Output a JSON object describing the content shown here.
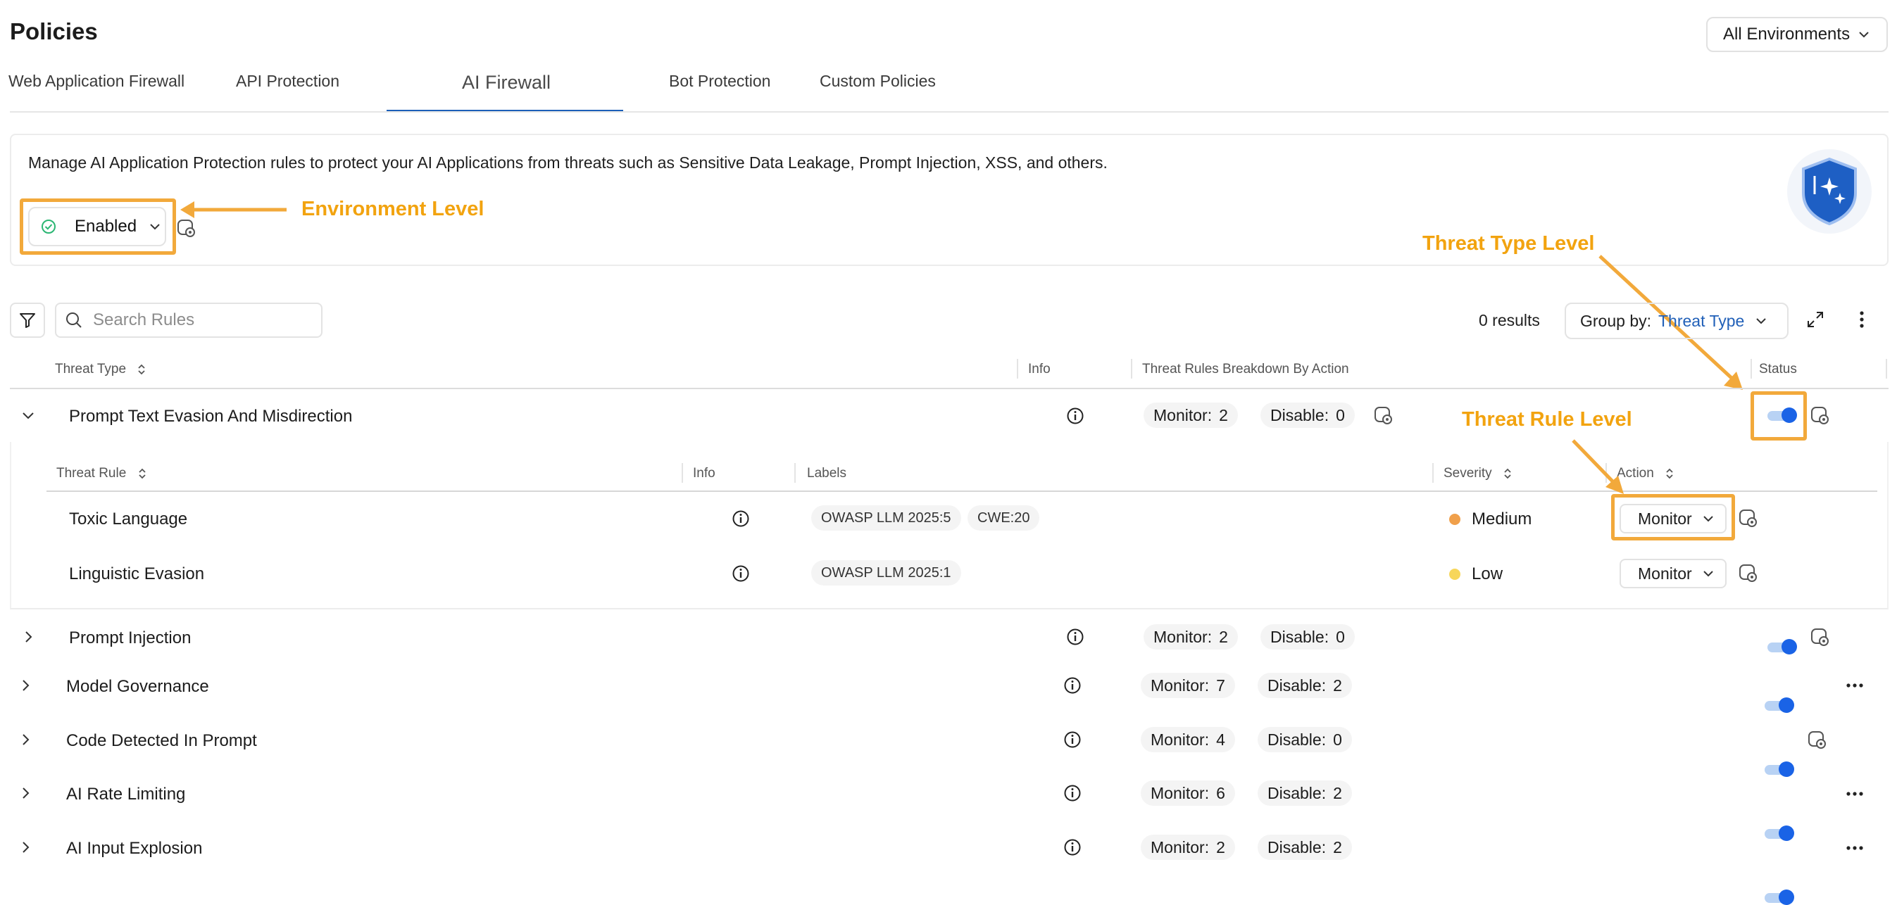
{
  "header": {
    "title": "Policies",
    "environment_select": "All Environments"
  },
  "tabs": [
    {
      "label": "Web Application Firewall",
      "active": false
    },
    {
      "label": "API Protection",
      "active": false
    },
    {
      "label": "AI Firewall",
      "active": true
    },
    {
      "label": "Bot Protection",
      "active": false
    },
    {
      "label": "Custom Policies",
      "active": false
    }
  ],
  "intro": {
    "description": "Manage AI Application Protection rules to protect your AI Applications from threats such as Sensitive Data Leakage, Prompt Injection, XSS, and others.",
    "status_label": "Enabled"
  },
  "annotations": {
    "environment_level": "Environment Level",
    "threat_type_level": "Threat Type Level",
    "threat_rule_level": "Threat Rule Level",
    "accent_color": "#f2a93b"
  },
  "toolbar": {
    "search_placeholder": "Search Rules",
    "results": "0 results",
    "group_by_label": "Group by:",
    "group_by_value": "Threat Type"
  },
  "table": {
    "columns": {
      "threat_type": "Threat Type",
      "info": "Info",
      "breakdown": "Threat Rules Breakdown By Action",
      "status": "Status"
    },
    "monitor_label": "Monitor:",
    "disable_label": "Disable:",
    "rows": [
      {
        "name": "Prompt Text Evasion And Misdirection",
        "monitor": "2",
        "disable": "0",
        "expanded": true,
        "enabled": true,
        "trailing": "policy-icon"
      },
      {
        "name": "Prompt Injection",
        "monitor": "2",
        "disable": "0",
        "expanded": false,
        "enabled": true,
        "trailing": "policy-icon"
      },
      {
        "name": "Model Governance",
        "monitor": "7",
        "disable": "2",
        "expanded": false,
        "enabled": true,
        "trailing": "more-icon"
      },
      {
        "name": "Code Detected In Prompt",
        "monitor": "4",
        "disable": "0",
        "expanded": false,
        "enabled": true,
        "trailing": "policy-icon"
      },
      {
        "name": "AI Rate Limiting",
        "monitor": "6",
        "disable": "2",
        "expanded": false,
        "enabled": true,
        "trailing": "more-icon"
      },
      {
        "name": "AI Input Explosion",
        "monitor": "2",
        "disable": "2",
        "expanded": false,
        "enabled": true,
        "trailing": "more-icon"
      }
    ]
  },
  "subtable": {
    "columns": {
      "threat_rule": "Threat Rule",
      "info": "Info",
      "labels": "Labels",
      "severity": "Severity",
      "action": "Action"
    },
    "rows": [
      {
        "name": "Toxic Language",
        "labels": [
          "OWASP LLM 2025:5",
          "CWE:20"
        ],
        "severity": "Medium",
        "severity_color": "#f0a04b",
        "action": "Monitor"
      },
      {
        "name": "Linguistic Evasion",
        "labels": [
          "OWASP LLM 2025:1"
        ],
        "severity": "Low",
        "severity_color": "#f7d65a",
        "action": "Monitor"
      }
    ]
  }
}
